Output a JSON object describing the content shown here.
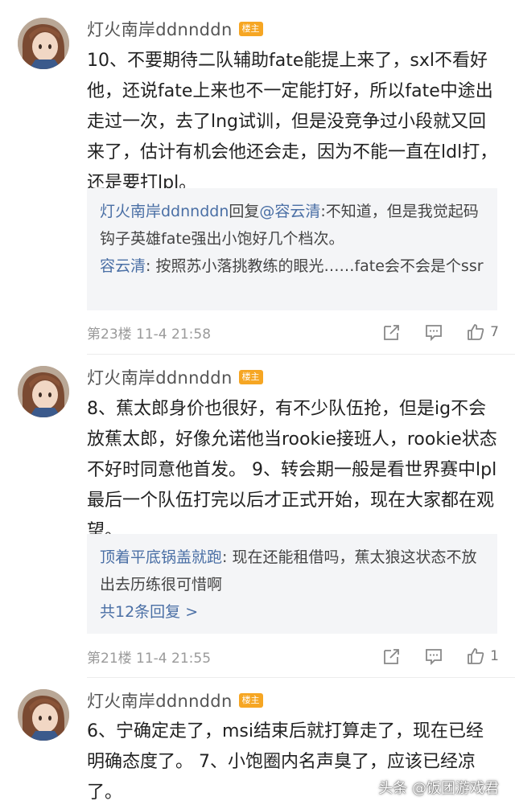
{
  "posts": [
    {
      "username": "灯火南岸ddnnddn",
      "badge": "楼主",
      "content": "10、不要期待二队辅助fate能提上来了，sxl不看好他，还说fate上来也不一定能打好，所以fate中途出走过一次，去了lng试训，但是没竞争过小段就又回来了，估计有机会他还会走，因为不能一直在ldl打，还是要打lpl。",
      "replies": [
        {
          "name": "灯火南岸ddnnddn",
          "mid": "回复",
          "to": "@容云清",
          "text": ":不知道，但是我觉起码钩子英雄fate强出小饱好几个档次。"
        },
        {
          "name": "容云清",
          "text": ": 按照苏小落挑教练的眼光……fate会不会是个ssr"
        }
      ],
      "meta": "第23楼  11-4  21:58",
      "likes": "7"
    },
    {
      "username": "灯火南岸ddnnddn",
      "badge": "楼主",
      "content": "8、蕉太郎身价也很好，有不少队伍抢，但是ig不会放蕉太郎，好像允诺他当rookie接班人，rookie状态不好时同意他首发。 9、转会期一般是看世界赛中lpl最后一个队伍打完以后才正式开始，现在大家都在观望。",
      "replies": [
        {
          "name": "顶着平底锅盖就跑",
          "text": ": 现在还能租借吗，蕉太狼这状态不放出去历练很可惜啊"
        }
      ],
      "more": "共12条回复 >",
      "meta": "第21楼  11-4  21:55",
      "likes": "1"
    },
    {
      "username": "灯火南岸ddnnddn",
      "badge": "楼主",
      "content": "6、宁确定走了，msi结束后就打算走了，现在已经明确态度了。 7、小饱圈内名声臭了，应该已经凉了。"
    }
  ],
  "watermark": "头条 @饭团游戏君",
  "colors": {
    "accent": "#4a6fa5",
    "badge": "#f6a623",
    "reply_bg": "#f4f5f7"
  },
  "icons": [
    "avatar",
    "share-icon",
    "comment-icon",
    "thumbs-up-icon"
  ]
}
